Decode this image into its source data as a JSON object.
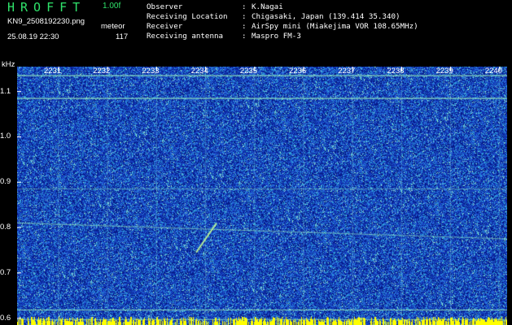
{
  "app": {
    "title": "HROFFT",
    "version": "1.00f",
    "file_name": "KN9_2508192230.png",
    "mode": "meteor",
    "datetime": "25.08.19 22:30",
    "count": "117"
  },
  "meta": [
    {
      "key": "Observer",
      "value": "K.Nagai"
    },
    {
      "key": "Receiving Location",
      "value": "Chigasaki, Japan (139.414 35.340)"
    },
    {
      "key": "Receiver",
      "value": "AirSpy mini (Miakejima VOR 108.65MHz)"
    },
    {
      "key": "Receiving antenna",
      "value": "Maspro FM-3"
    }
  ],
  "spectrogram": {
    "y_unit": "kHz",
    "y_ticks": [
      "1.1",
      "1.0",
      "0.9",
      "0.8",
      "0.7",
      "0.6"
    ],
    "y_values": [
      1.1,
      1.0,
      0.9,
      0.8,
      0.7,
      0.6
    ],
    "y_range": [
      0.585,
      1.155
    ],
    "x_ticks": [
      "2231",
      "2232",
      "2233",
      "2234",
      "2235",
      "2236",
      "2237",
      "2238",
      "2239",
      "2240"
    ],
    "colors": {
      "background": "#0b2a9e",
      "noise_dark": "#061a86",
      "noise_mid": "#1f5ad6",
      "noise_bright": "#2fb3d9",
      "signal": "#6ee6a8",
      "header_green": "#2fe26a",
      "bottom_bar": "#ffff00"
    }
  }
}
